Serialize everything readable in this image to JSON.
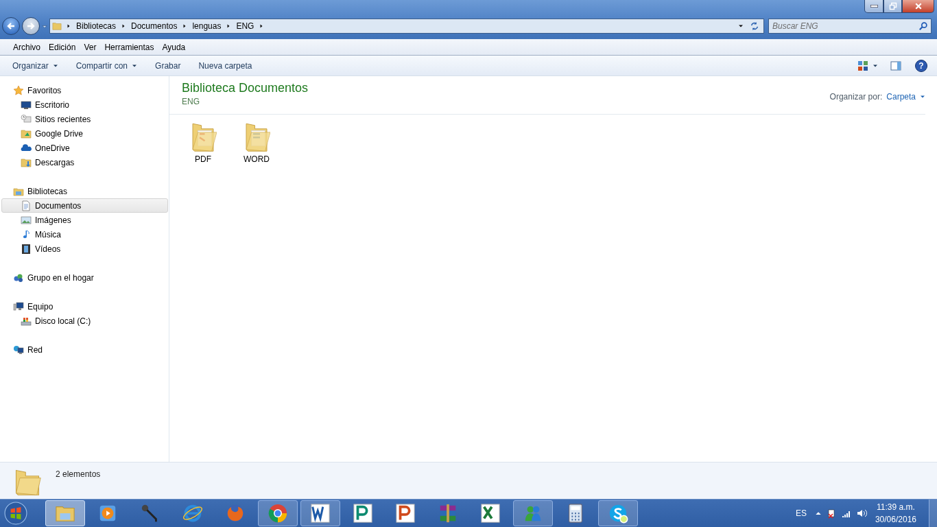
{
  "address_bar": {
    "breadcrumbs": [
      "Bibliotecas",
      "Documentos",
      "lenguas",
      "ENG"
    ]
  },
  "search": {
    "placeholder": "Buscar ENG"
  },
  "help_button": "?",
  "menu": [
    "Archivo",
    "Edición",
    "Ver",
    "Herramientas",
    "Ayuda"
  ],
  "commands": [
    {
      "label": "Organizar",
      "dropdown": true
    },
    {
      "label": "Compartir con",
      "dropdown": true
    },
    {
      "label": "Grabar",
      "dropdown": false
    },
    {
      "label": "Nueva carpeta",
      "dropdown": false
    }
  ],
  "sidebar": [
    {
      "label": "Favoritos",
      "kind": "star",
      "selected": false,
      "children": [
        {
          "label": "Escritorio",
          "kind": "desktop",
          "selected": false
        },
        {
          "label": "Sitios recientes",
          "kind": "recent",
          "selected": false
        },
        {
          "label": "Google Drive",
          "kind": "gdrive",
          "selected": false
        },
        {
          "label": "OneDrive",
          "kind": "onedrive",
          "selected": false
        },
        {
          "label": "Descargas",
          "kind": "downloads",
          "selected": false
        }
      ]
    },
    {
      "label": "Bibliotecas",
      "kind": "library",
      "selected": false,
      "children": [
        {
          "label": "Documentos",
          "kind": "document",
          "selected": true
        },
        {
          "label": "Imágenes",
          "kind": "pictures",
          "selected": false
        },
        {
          "label": "Música",
          "kind": "music",
          "selected": false
        },
        {
          "label": "Vídeos",
          "kind": "videos",
          "selected": false
        }
      ]
    },
    {
      "label": "Grupo en el hogar",
      "kind": "homegroup",
      "selected": false
    },
    {
      "label": "Equipo",
      "kind": "computer",
      "selected": false,
      "children": [
        {
          "label": "Disco local (C:)",
          "kind": "disk",
          "selected": false
        }
      ]
    },
    {
      "label": "Red",
      "kind": "network",
      "selected": false
    }
  ],
  "content": {
    "title": "Biblioteca Documentos",
    "subtitle": "ENG",
    "arrange_label": "Organizar por:",
    "arrange_value": "Carpeta",
    "items": [
      {
        "name": "PDF",
        "kind": "pdf"
      },
      {
        "name": "WORD",
        "kind": "word"
      }
    ]
  },
  "status_bar": {
    "count": "2 elementos"
  },
  "taskbar": {
    "apps": [
      {
        "kind": "explorer",
        "open": true,
        "selected": true
      },
      {
        "kind": "media",
        "open": false,
        "selected": false
      },
      {
        "kind": "mic",
        "open": false,
        "selected": false
      },
      {
        "kind": "ie",
        "open": false,
        "selected": false
      },
      {
        "kind": "firefox",
        "open": false,
        "selected": false
      },
      {
        "kind": "chrome",
        "open": true,
        "selected": false
      },
      {
        "kind": "word",
        "open": true,
        "selected": false
      },
      {
        "kind": "publisher",
        "open": false,
        "selected": false
      },
      {
        "kind": "powerpoint",
        "open": false,
        "selected": false
      },
      {
        "kind": "winrar",
        "open": false,
        "selected": false
      },
      {
        "kind": "excel",
        "open": false,
        "selected": false
      },
      {
        "kind": "messenger",
        "open": true,
        "selected": false
      },
      {
        "kind": "calculator",
        "open": false,
        "selected": false
      },
      {
        "kind": "skype",
        "open": true,
        "selected": false
      }
    ],
    "language": "ES",
    "time": "11:39 a.m.",
    "date": "30/06/2016"
  }
}
